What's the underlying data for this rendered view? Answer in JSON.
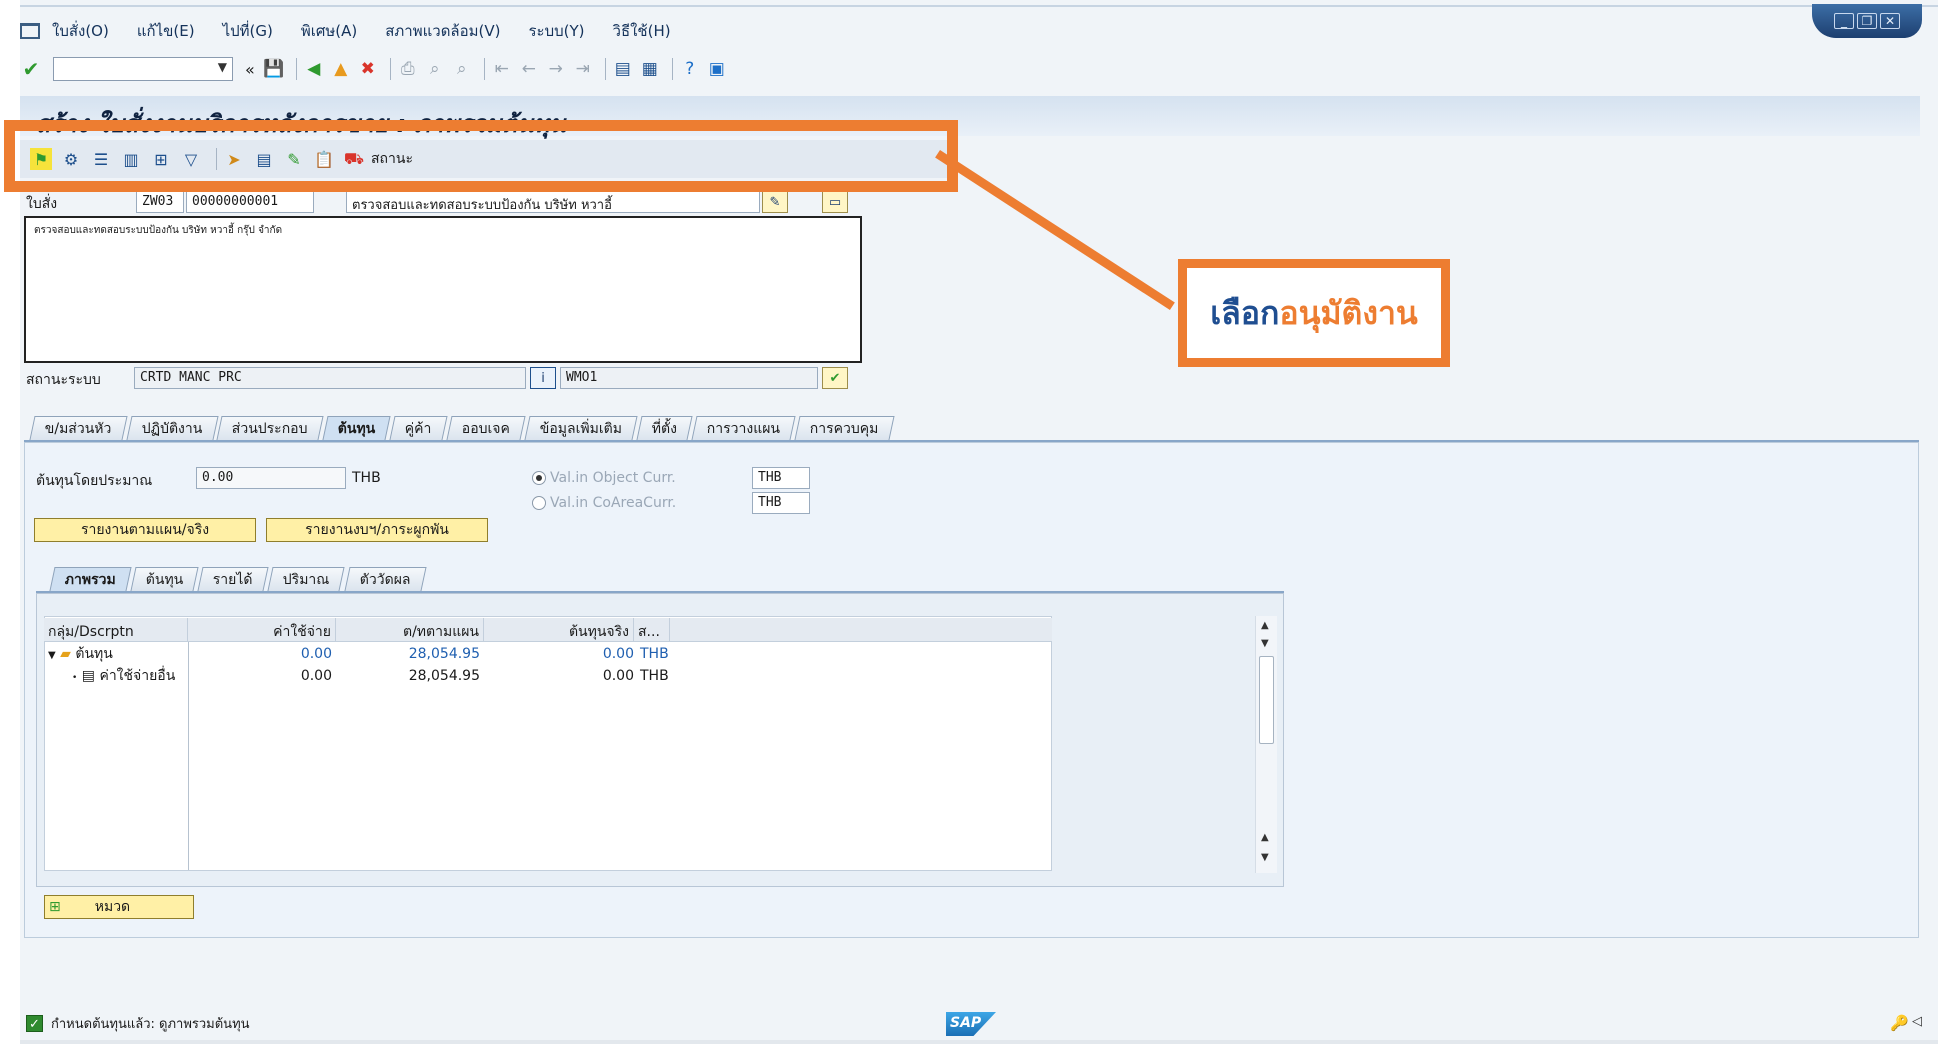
{
  "menu": {
    "items": [
      "ใบสั่ง(O)",
      "แก้ไข(E)",
      "ไปที่(G)",
      "พิเศษ(A)",
      "สภาพแวดล้อม(V)",
      "ระบบ(Y)",
      "วิธีใช้(H)"
    ]
  },
  "standard_toolbar": {
    "okcode_value": "",
    "back_glyph": "«"
  },
  "title": "สร้าง ใบสั่งงานบริการหลังการขาย : ภาพรวมต้นทุน",
  "app_toolbar": {
    "status_label": "สถานะ"
  },
  "callout": {
    "part1": "เลือก",
    "part2": "อนุมัติงาน"
  },
  "header": {
    "order_label": "ใบสั่ง",
    "order_type": "ZW03",
    "order_number": "00000000001",
    "order_description": "ตรวจสอบและทดสอบระบบป้องกัน บริษัท หวาอี้",
    "long_text": "ตรวจสอบและทดสอบระบบป้องกัน บริษัท หวาอี้ กรุ๊ป จำกัด",
    "system_status_label": "สถานะระบบ",
    "system_status": "CRTD MANC PRC",
    "user_status": "WMO1"
  },
  "tabs": [
    "ข/มส่วนหัว",
    "ปฏิบัติงาน",
    "ส่วนประกอบ",
    "ต้นทุน",
    "คู่ค้า",
    "ออบเจค",
    "ข้อมูลเพิ่มเติม",
    "ที่ตั้ง",
    "การวางแผน",
    "การควบคุม"
  ],
  "active_tab": "ต้นทุน",
  "costs": {
    "estimated_label": "ต้นทุนโดยประมาณ",
    "estimated_value": "0.00",
    "estimated_currency": "THB",
    "radio_object_label": "Val.in Object Curr.",
    "radio_object_currency": "THB",
    "radio_coarea_label": "Val.in CoAreaCurr.",
    "radio_coarea_currency": "THB",
    "btn_plan_actual": "รายงานตามแผน/จริง",
    "btn_budget": "รายงานงบฯ/ภาระผูกพัน"
  },
  "inner_tabs": [
    "ภาพรวม",
    "ต้นทุน",
    "รายได้",
    "ปริมาณ",
    "ตัววัดผล"
  ],
  "active_inner_tab": "ภาพรวม",
  "grid": {
    "columns": [
      "กลุ่ม/Dscrptn",
      "ค่าใช้จ่าย",
      "ต/ทตามแผน",
      "ต้นทุนจริง",
      "ส..."
    ],
    "rows": [
      {
        "label": "ต้นทุน",
        "cost": "0.00",
        "plan": "28,054.95",
        "actual": "0.00",
        "curr": "THB"
      },
      {
        "label": "ค่าใช้จ่ายอื่น",
        "cost": "0.00",
        "plan": "28,054.95",
        "actual": "0.00",
        "curr": "THB"
      }
    ]
  },
  "category_button": "หมวด",
  "status_bar": {
    "message": "กำหนดต้นทุนแล้ว: ดูภาพรวมต้นทุน",
    "sap_logo": "SAP"
  },
  "colors": {
    "highlight": "#ed7d31",
    "callout_text": "#1f4e91",
    "link_blue": "#1f5fb0"
  }
}
